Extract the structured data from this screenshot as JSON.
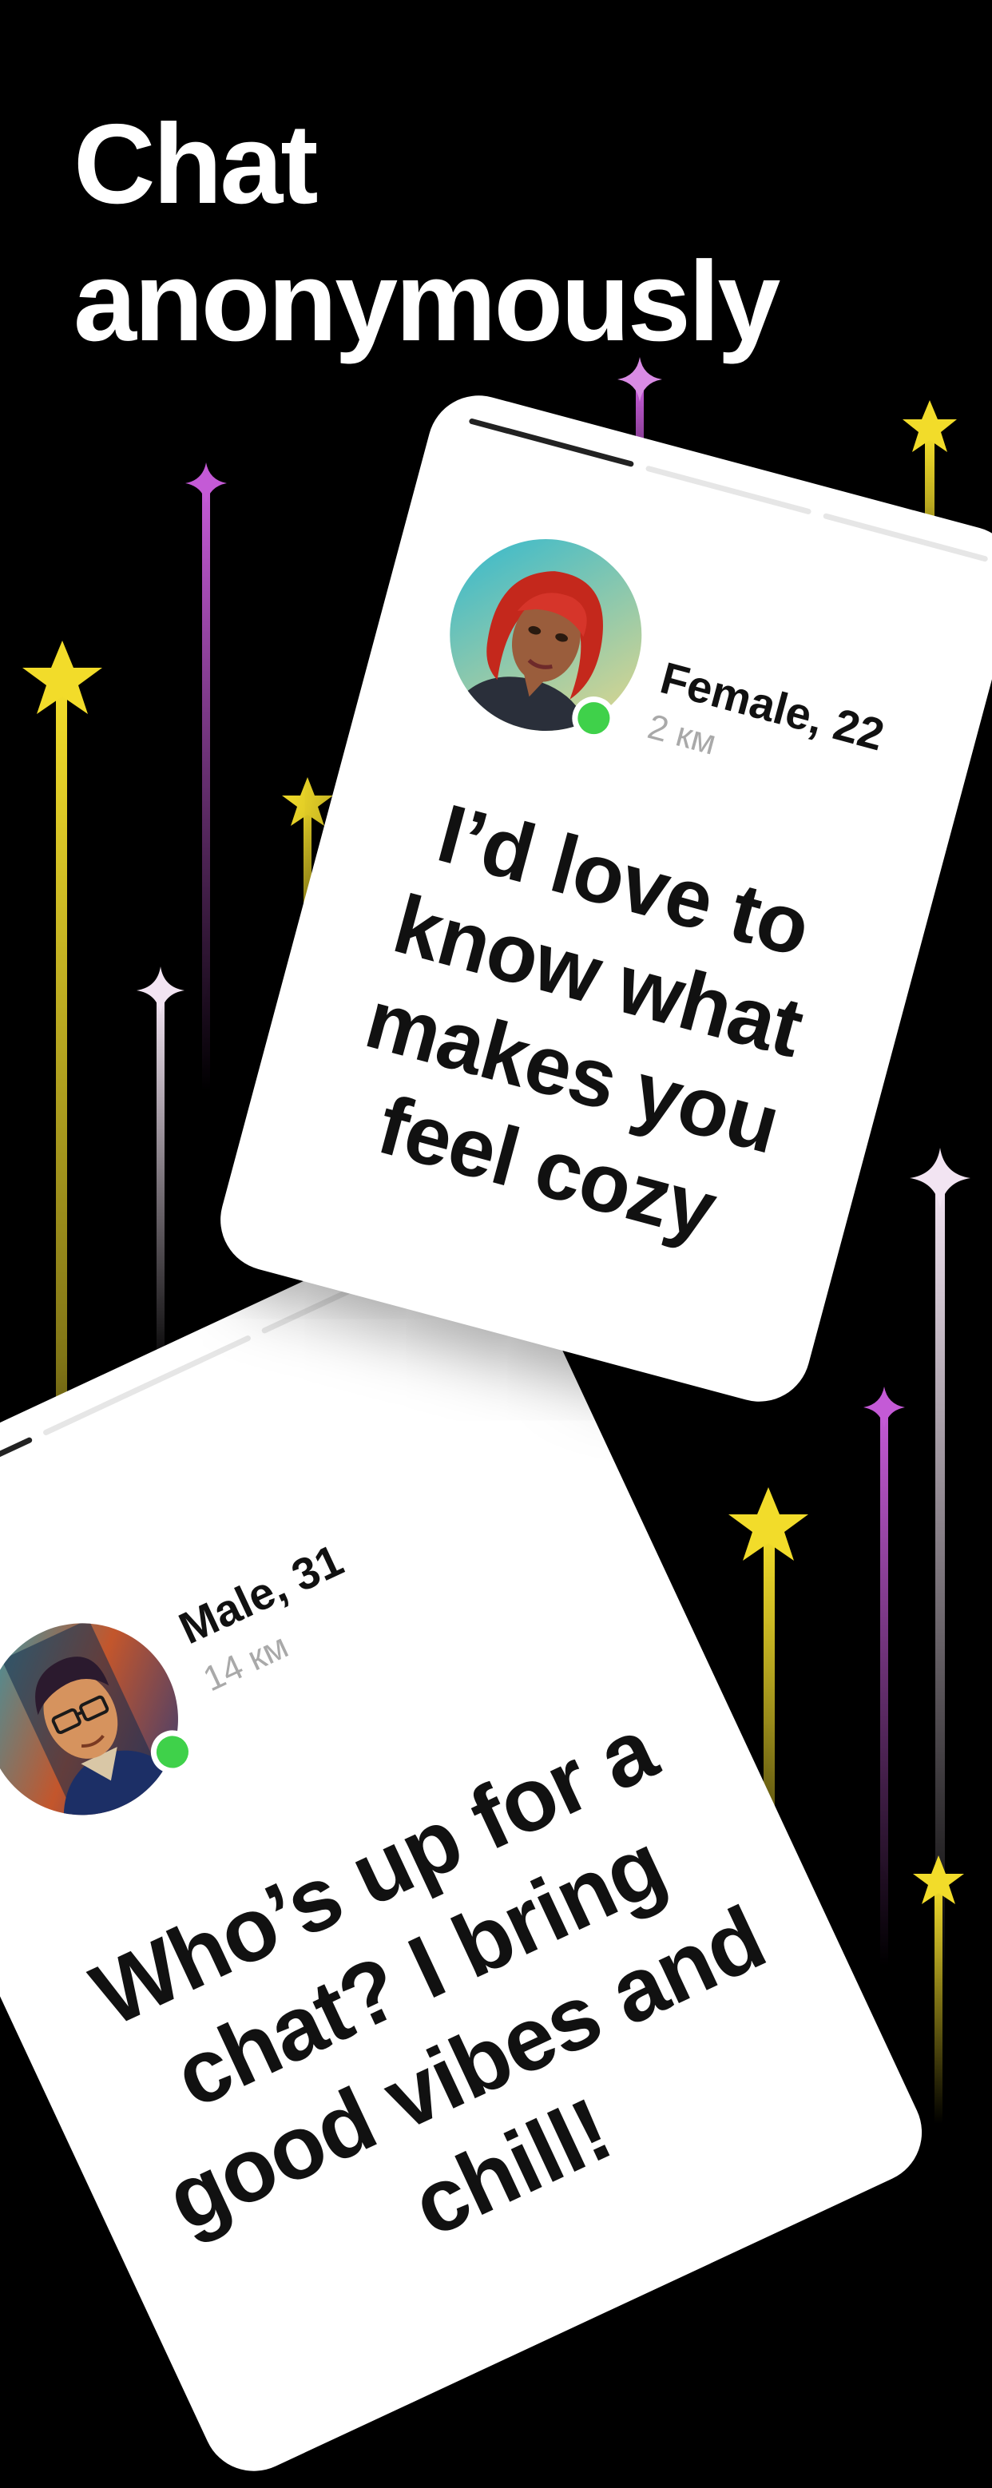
{
  "headline": {
    "line1": "Chat",
    "line2": "anonymously"
  },
  "colors": {
    "background": "#000000",
    "card": "#ffffff",
    "online": "#3fd14a",
    "star_yellow": "#f2dc2a",
    "star_purple": "#c45ad6",
    "star_white": "#f2e4f2"
  },
  "cards": [
    {
      "name": "Female, 22",
      "distance": "2 км",
      "message": "I’d love to know what makes you feel cozy",
      "avatar_icon": "woman-red-hair-avatar",
      "status": "online"
    },
    {
      "name": "Male, 31",
      "distance": "14 км",
      "message": "Who’s up for a chat? I bring good vibes and chill!",
      "avatar_icon": "man-glasses-avatar",
      "status": "online"
    }
  ]
}
